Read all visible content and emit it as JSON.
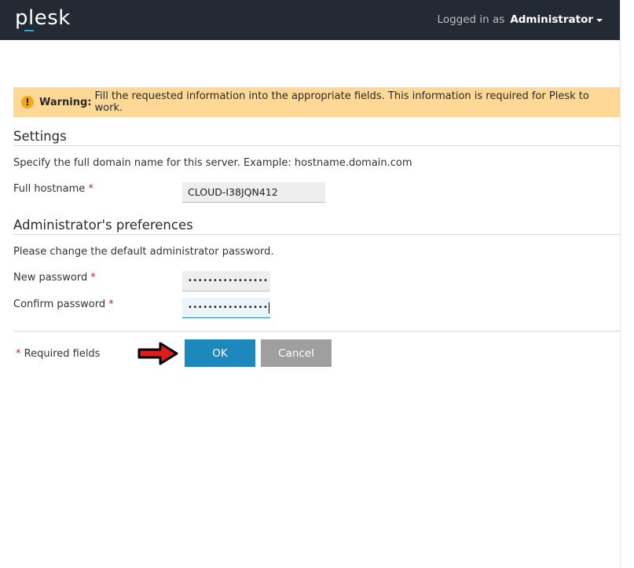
{
  "header": {
    "logo": "plesk",
    "logged_in_prefix": "Logged in as",
    "user_name": "Administrator"
  },
  "warning": {
    "label": "Warning:",
    "message": "Fill the requested information into the appropriate fields. This information is required for Plesk to work."
  },
  "settings": {
    "title": "Settings",
    "hint": "Specify the full domain name for this server. Example: hostname.domain.com",
    "hostname_label": "Full hostname",
    "hostname_value": "CLOUD-I38JQN412"
  },
  "admin_prefs": {
    "title": "Administrator's preferences",
    "hint": "Please change the default administrator password.",
    "new_password_label": "New password",
    "new_password_value": "••••••••••••••••",
    "confirm_password_label": "Confirm password",
    "confirm_password_value": "••••••••••••••••"
  },
  "required_marker": "*",
  "required_note": "Required fields",
  "buttons": {
    "ok": "OK",
    "cancel": "Cancel"
  },
  "colors": {
    "header_bg": "#232a33",
    "warning_bg": "#fdd896",
    "ok_bg": "#1c88bb",
    "cancel_bg": "#9f9f9f",
    "required": "#c92727"
  }
}
